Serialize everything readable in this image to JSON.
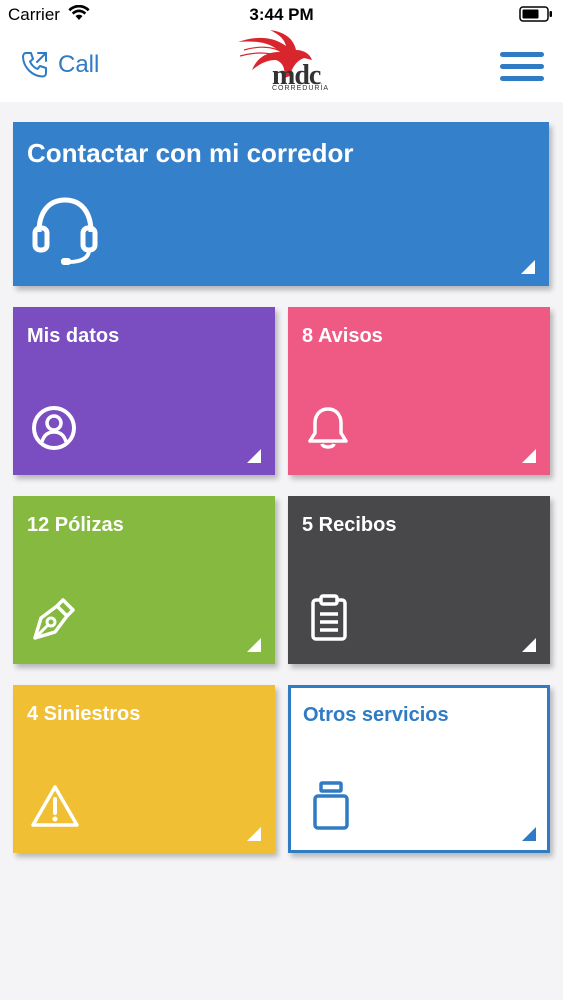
{
  "status_bar": {
    "carrier": "Carrier",
    "time": "3:44 PM"
  },
  "header": {
    "call_label": "Call",
    "logo_text": "mdc",
    "logo_sub": "CORREDURÍA"
  },
  "tiles": {
    "contact": {
      "title": "Contactar con mi corredor",
      "icon": "headset-icon"
    },
    "datos": {
      "title": "Mis datos",
      "icon": "user-circle-icon"
    },
    "avisos": {
      "title": "8 Avisos",
      "icon": "bell-icon"
    },
    "polizas": {
      "title": "12 Pólizas",
      "icon": "pen-nib-icon"
    },
    "recibos": {
      "title": "5 Recibos",
      "icon": "clipboard-icon"
    },
    "siniestros": {
      "title": "4 Siniestros",
      "icon": "warning-icon"
    },
    "otros": {
      "title": "Otros servicios",
      "icon": "jar-icon"
    }
  },
  "colors": {
    "accent": "#2f7bc4",
    "contact": "#3580cb",
    "datos": "#7a4dc1",
    "avisos": "#ef5a84",
    "polizas": "#86b93f",
    "recibos": "#48484b",
    "siniestros": "#f0bf33",
    "logo_red": "#d9262e"
  }
}
